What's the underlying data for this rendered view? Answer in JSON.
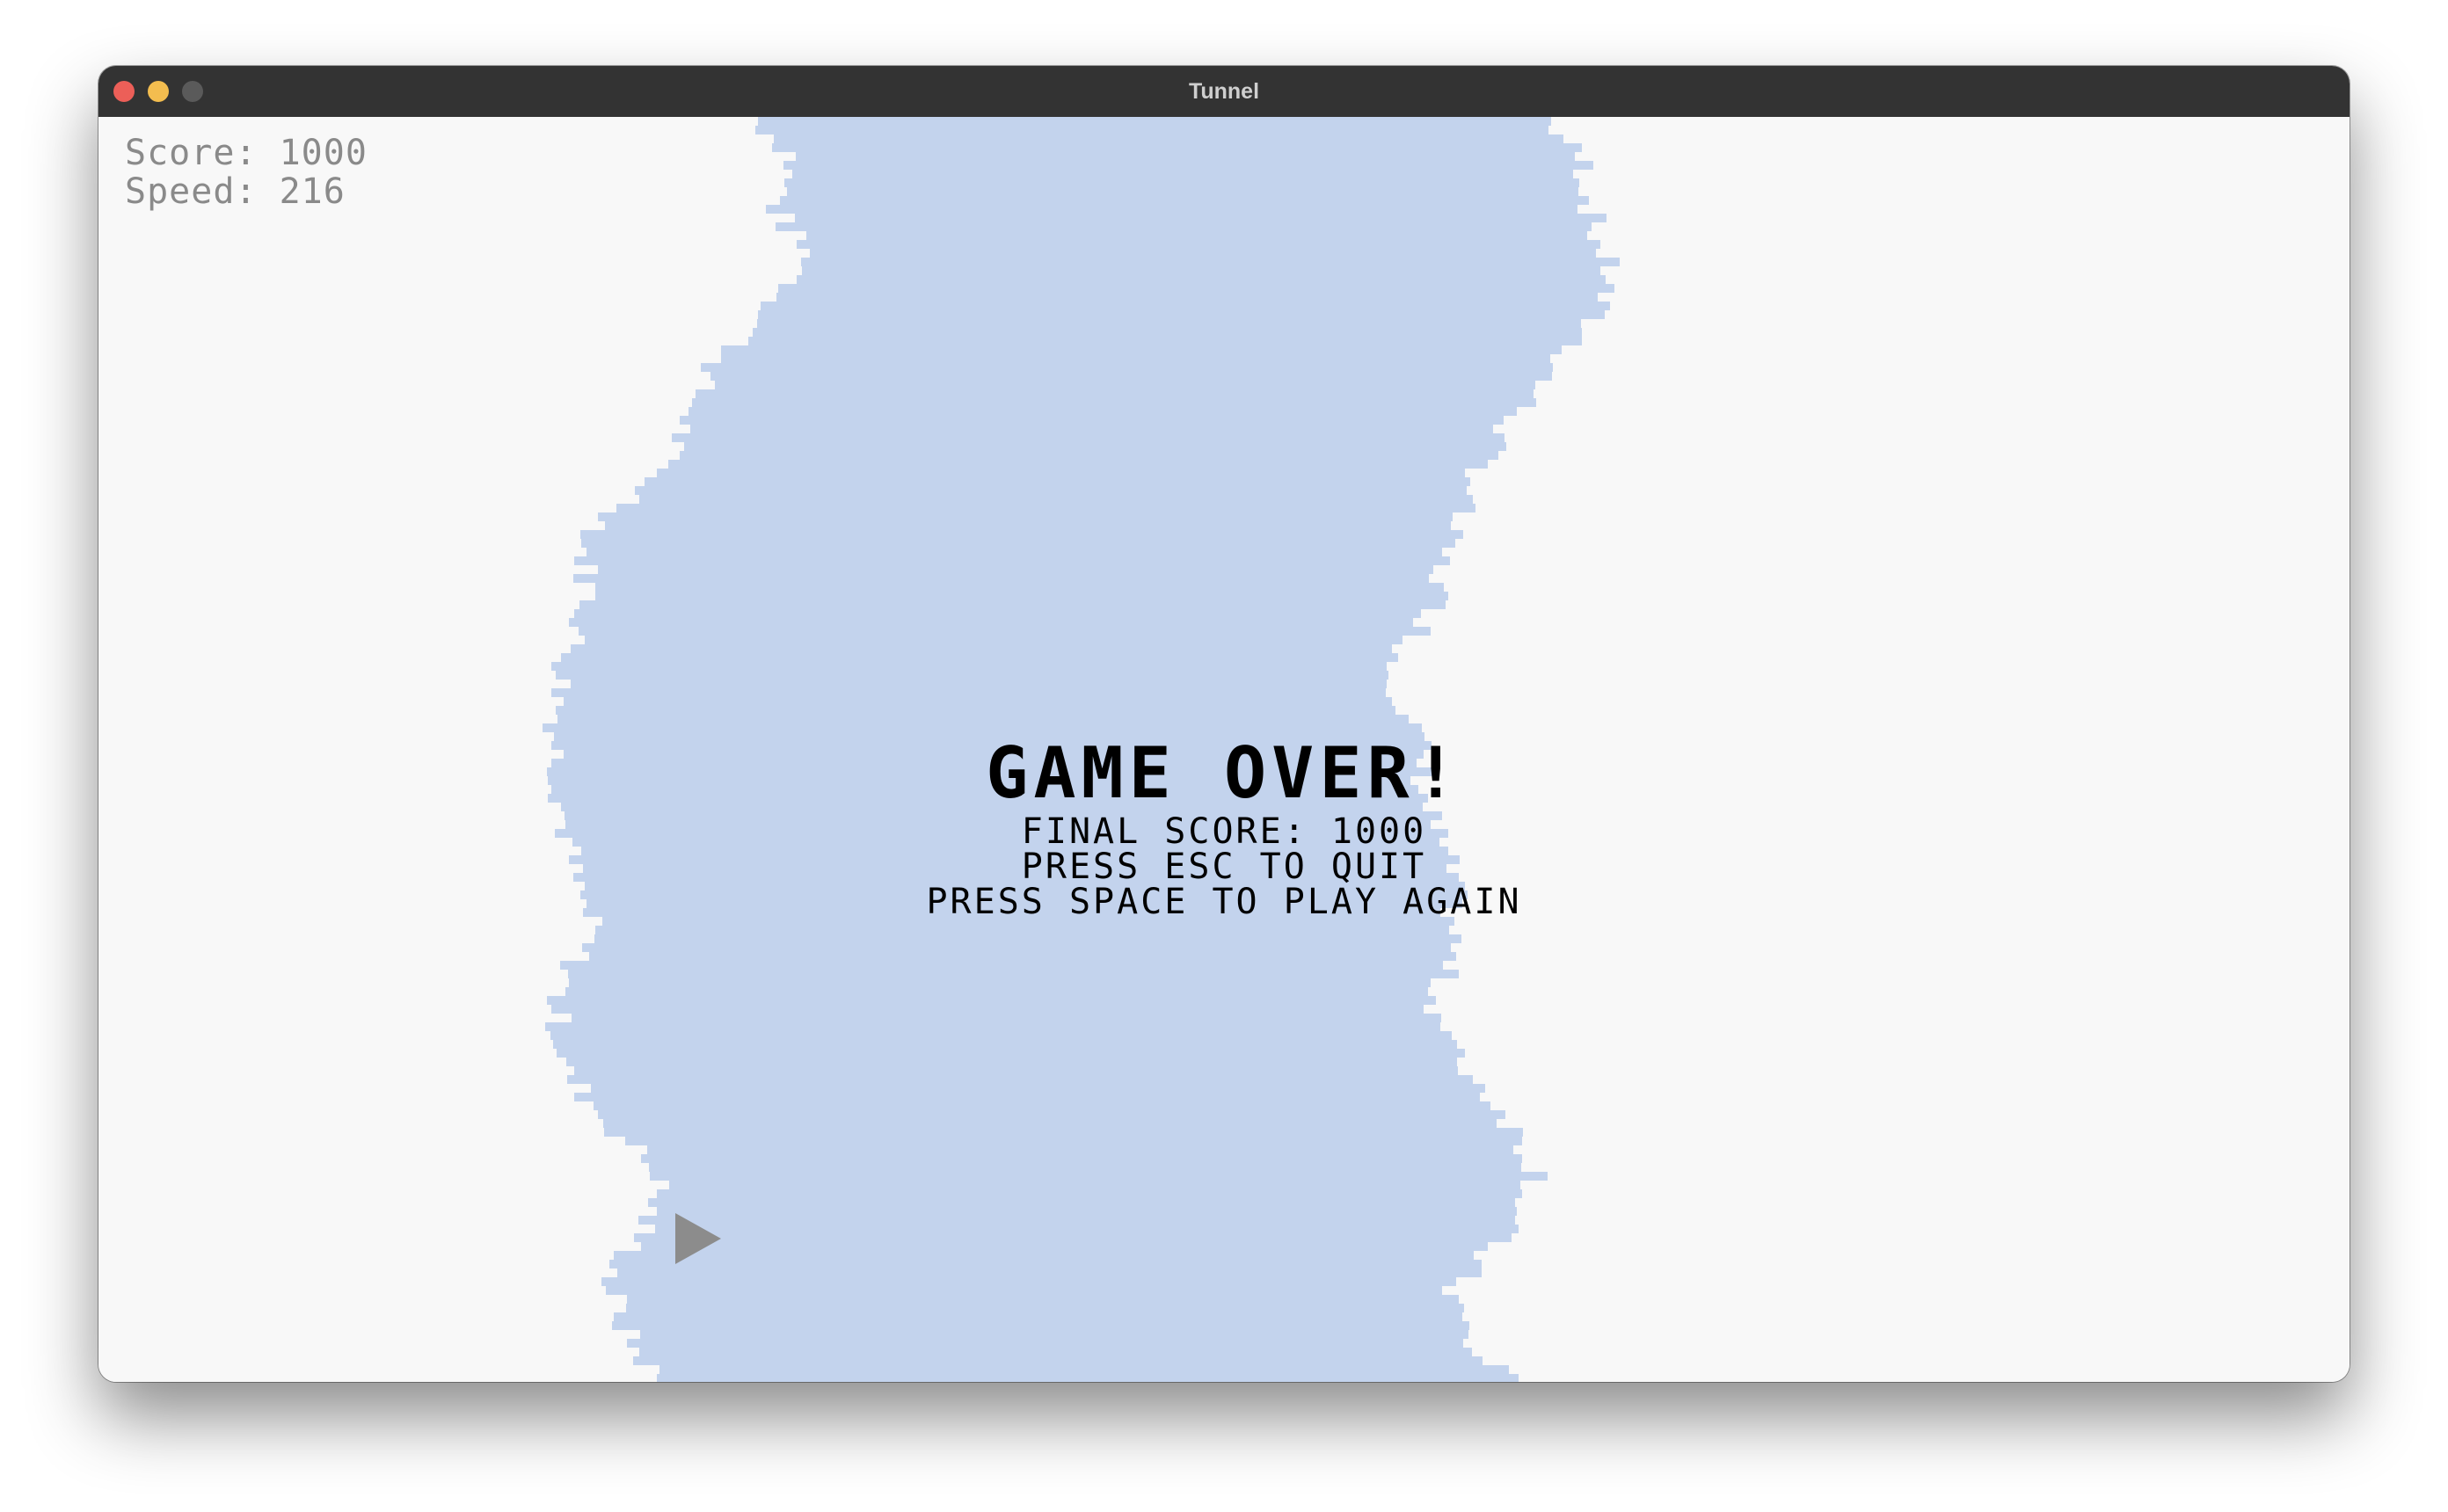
{
  "window": {
    "title": "Tunnel",
    "buttons": {
      "close_color": "#ec5f58",
      "minimize_color": "#f3bd4f",
      "zoom_color": "#5a5a5a"
    }
  },
  "hud": {
    "score_text": "Score: 1000",
    "speed_text": "Speed: 216"
  },
  "game_over": {
    "title": "GAME OVER!",
    "final_score_text": "FINAL SCORE: 1000",
    "quit_text": "PRESS ESC TO QUIT",
    "restart_text": "PRESS SPACE TO PLAY AGAIN"
  },
  "colors": {
    "background": "#f8f8f8",
    "tunnel": "#c3d3ed",
    "player": "#8c8c8c",
    "text": "#000000",
    "hud_text": "#8a8a8a"
  },
  "player": {
    "shape": "triangle-right"
  }
}
